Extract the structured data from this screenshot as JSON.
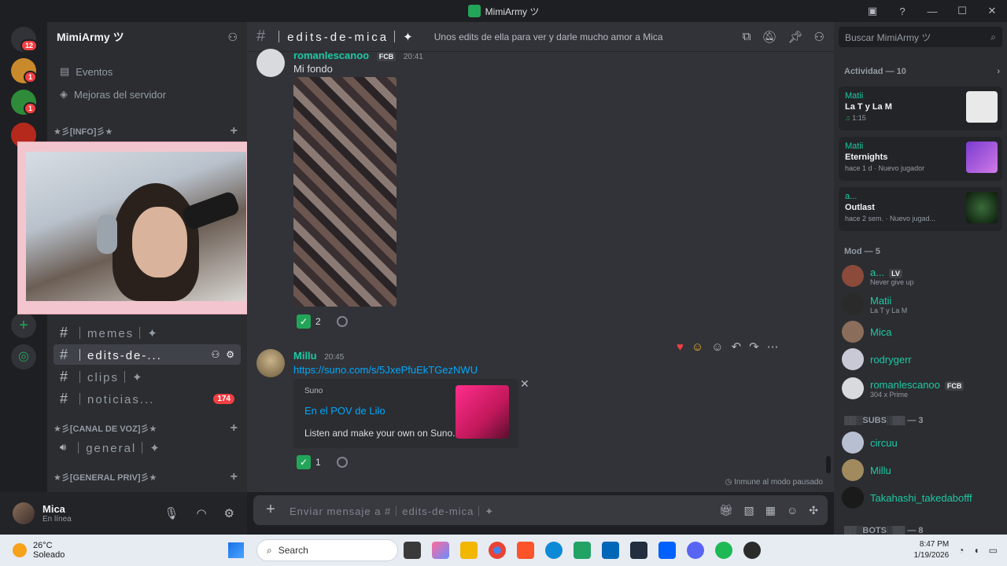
{
  "window": {
    "title": "MimiArmy ツ"
  },
  "server": {
    "name": "MimiArmy ツ",
    "rail_badges": [
      "12",
      "1",
      "1"
    ]
  },
  "sidebar": {
    "top_items": [
      {
        "label": "Eventos"
      },
      {
        "label": "Mejoras del servidor"
      }
    ],
    "categories": [
      {
        "label": "★彡[INFO]彡★"
      },
      {
        "label": "★彡[CANAL DE VOZ]彡★"
      },
      {
        "label": "★彡[GENERAL PRIV]彡★"
      }
    ],
    "channels": [
      {
        "label": "｜memes｜✦"
      },
      {
        "label": "｜edits-de-..."
      },
      {
        "label": "｜clips｜✦"
      },
      {
        "label": "｜noticias...",
        "badge": "174"
      }
    ],
    "voice_channels": [
      {
        "label": "｜general｜✦"
      }
    ]
  },
  "user_panel": {
    "name": "Mica",
    "status": "En línea"
  },
  "chat": {
    "channel_name": "｜edits-de-mica｜✦",
    "topic": "Unos edits de ella para ver y darle mucho amor a Mica",
    "messages": [
      {
        "author": "romanlescanoo",
        "tag": "FCB",
        "time": "20:41",
        "text": "Mi fondo",
        "reaction_count": "2"
      },
      {
        "author": "Millu",
        "time": "20:45",
        "link": "https://suno.com/s/5JxePfuEkTGezNWU",
        "embed": {
          "provider": "Suno",
          "title": "En el POV de Lilo",
          "description": "Listen and make your own on Suno."
        },
        "reaction_count": "1"
      }
    ],
    "status_note": "Inmune al modo pausado",
    "composer_placeholder": "Enviar mensaje a #｜edits-de-mica｜✦"
  },
  "members": {
    "search_placeholder": "Buscar MimiArmy ツ",
    "activity_header": "Actividad — 10",
    "activities": [
      {
        "user": "Matii",
        "game": "La T y La M",
        "meta": "1:15"
      },
      {
        "user": "Matii",
        "game": "Eternights",
        "meta": "hace 1 d",
        "extra": "Nuevo jugador"
      },
      {
        "user": "a...",
        "game": "Outlast",
        "meta": "hace 2 sem.",
        "extra": "Nuevo jugad..."
      }
    ],
    "mod_header": "Mod — 5",
    "mods": [
      {
        "name": "a...",
        "tag": "LV",
        "sub": "Never give up"
      },
      {
        "name": "Matii",
        "sub": "La T y La M"
      },
      {
        "name": "Mica",
        "sub": ""
      },
      {
        "name": "rodrygerr",
        "sub": ""
      },
      {
        "name": "romanlescanoo",
        "tag": "FCB",
        "sub": "304 x Prime"
      }
    ],
    "subs_header": "▒▒░SUBS░▒▒ — 3",
    "subs": [
      {
        "name": "circuu"
      },
      {
        "name": "Millu"
      },
      {
        "name": "Takahashi_takedabofff"
      }
    ],
    "bots_header": "▒▒░BOTS░▒▒ — 8"
  },
  "taskbar": {
    "weather_temp": "26°C",
    "weather_desc": "Soleado",
    "search_label": "Search",
    "time": "8:47 PM",
    "date": "1/19/2026"
  },
  "colors": {
    "accent": "#5865f2",
    "mod_name": "#1dc9a4",
    "link": "#00a8fc"
  }
}
